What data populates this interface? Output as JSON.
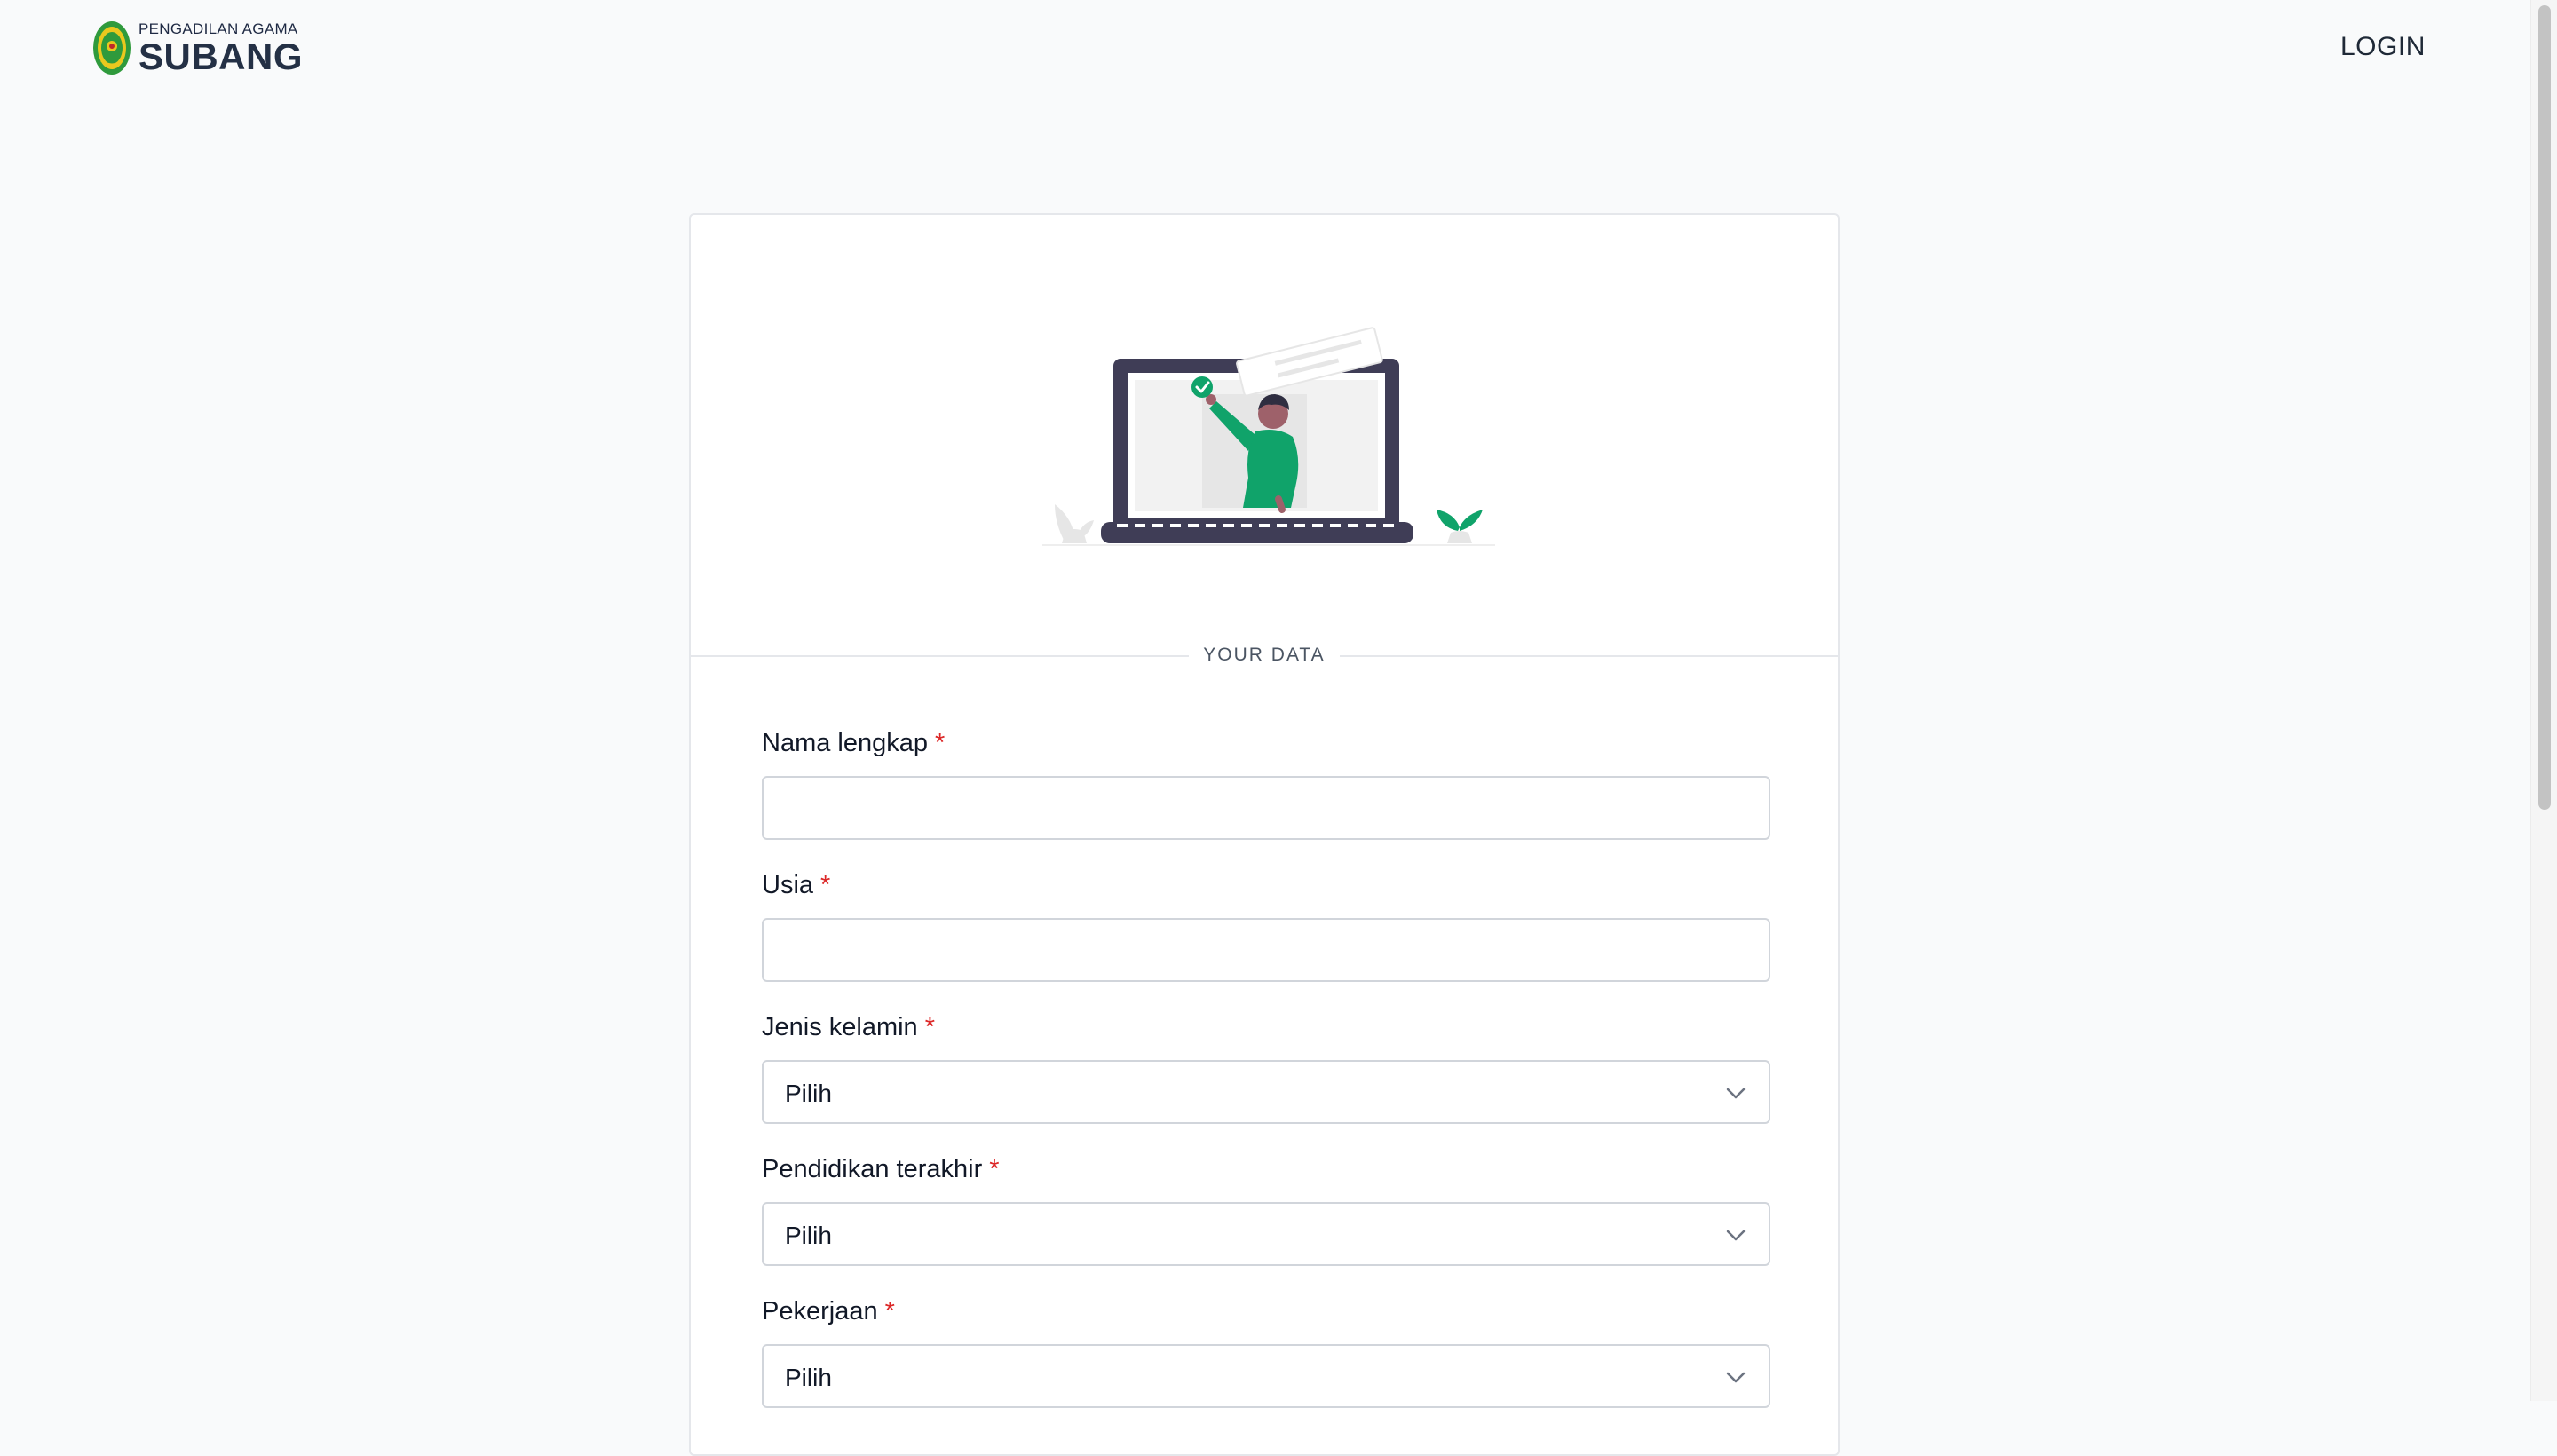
{
  "header": {
    "logo_small": "PENGADILAN AGAMA",
    "logo_big": "SUBANG",
    "login_label": "LOGIN"
  },
  "section_label": "YOUR DATA",
  "form": {
    "required_mark": "*",
    "fields": [
      {
        "label": "Nama lengkap",
        "type": "text",
        "value": ""
      },
      {
        "label": "Usia",
        "type": "text",
        "value": ""
      },
      {
        "label": "Jenis kelamin",
        "type": "select",
        "value": "Pilih"
      },
      {
        "label": "Pendidikan terakhir",
        "type": "select",
        "value": "Pilih"
      },
      {
        "label": "Pekerjaan",
        "type": "select",
        "value": "Pilih"
      }
    ]
  },
  "icons": {
    "logo": "court-emblem-icon",
    "illustration": "laptop-person-illustration",
    "dropdown": "chevron-down-icon"
  },
  "colors": {
    "accent": "#10a36a",
    "background": "#f9fafb",
    "required": "#dc2626",
    "laptop": "#3f3d56"
  }
}
